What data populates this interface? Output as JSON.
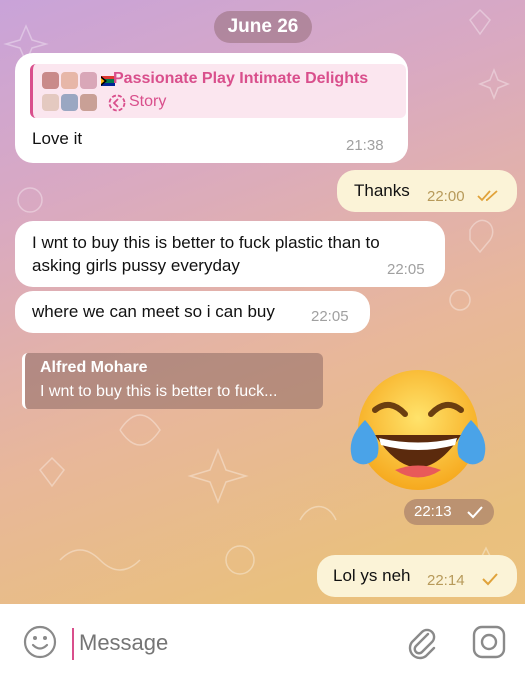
{
  "chat": {
    "date_divider": "June 26",
    "messages": [
      {
        "direction": "incoming",
        "story_reply": {
          "title": "Passionate Play Intimate Delights",
          "subtitle": "Story"
        },
        "text": "Love it",
        "time": "21:38"
      },
      {
        "direction": "outgoing",
        "text": "Thanks",
        "time": "22:00",
        "status": "read"
      },
      {
        "direction": "incoming",
        "text": "I wnt to buy this is better to fuck plastic than to asking girls pussy everyday",
        "line1": "I wnt to buy this is better to fuck plastic than to",
        "line2": "asking girls pussy everyday",
        "time": "22:05"
      },
      {
        "direction": "incoming",
        "text": "where we can meet so i can buy",
        "time": "22:05"
      },
      {
        "direction": "outgoing",
        "reply_to": {
          "name": "Alfred Mohare",
          "text": "I wnt to buy this is better to fuck..."
        },
        "emoji": "face-with-tears-of-joy",
        "time": "22:13",
        "status": "sent"
      },
      {
        "direction": "outgoing",
        "text": "Lol ys neh",
        "time": "22:14",
        "status": "sent"
      }
    ]
  },
  "composer": {
    "placeholder": "Message",
    "icons": [
      "emoji-icon",
      "attach-icon",
      "camera-icon"
    ]
  },
  "colors": {
    "story_accent": "#d94f8c",
    "outgoing_bubble": "#fbf3d7",
    "incoming_bubble": "#ffffff",
    "read_tick": "#e0a23a"
  }
}
